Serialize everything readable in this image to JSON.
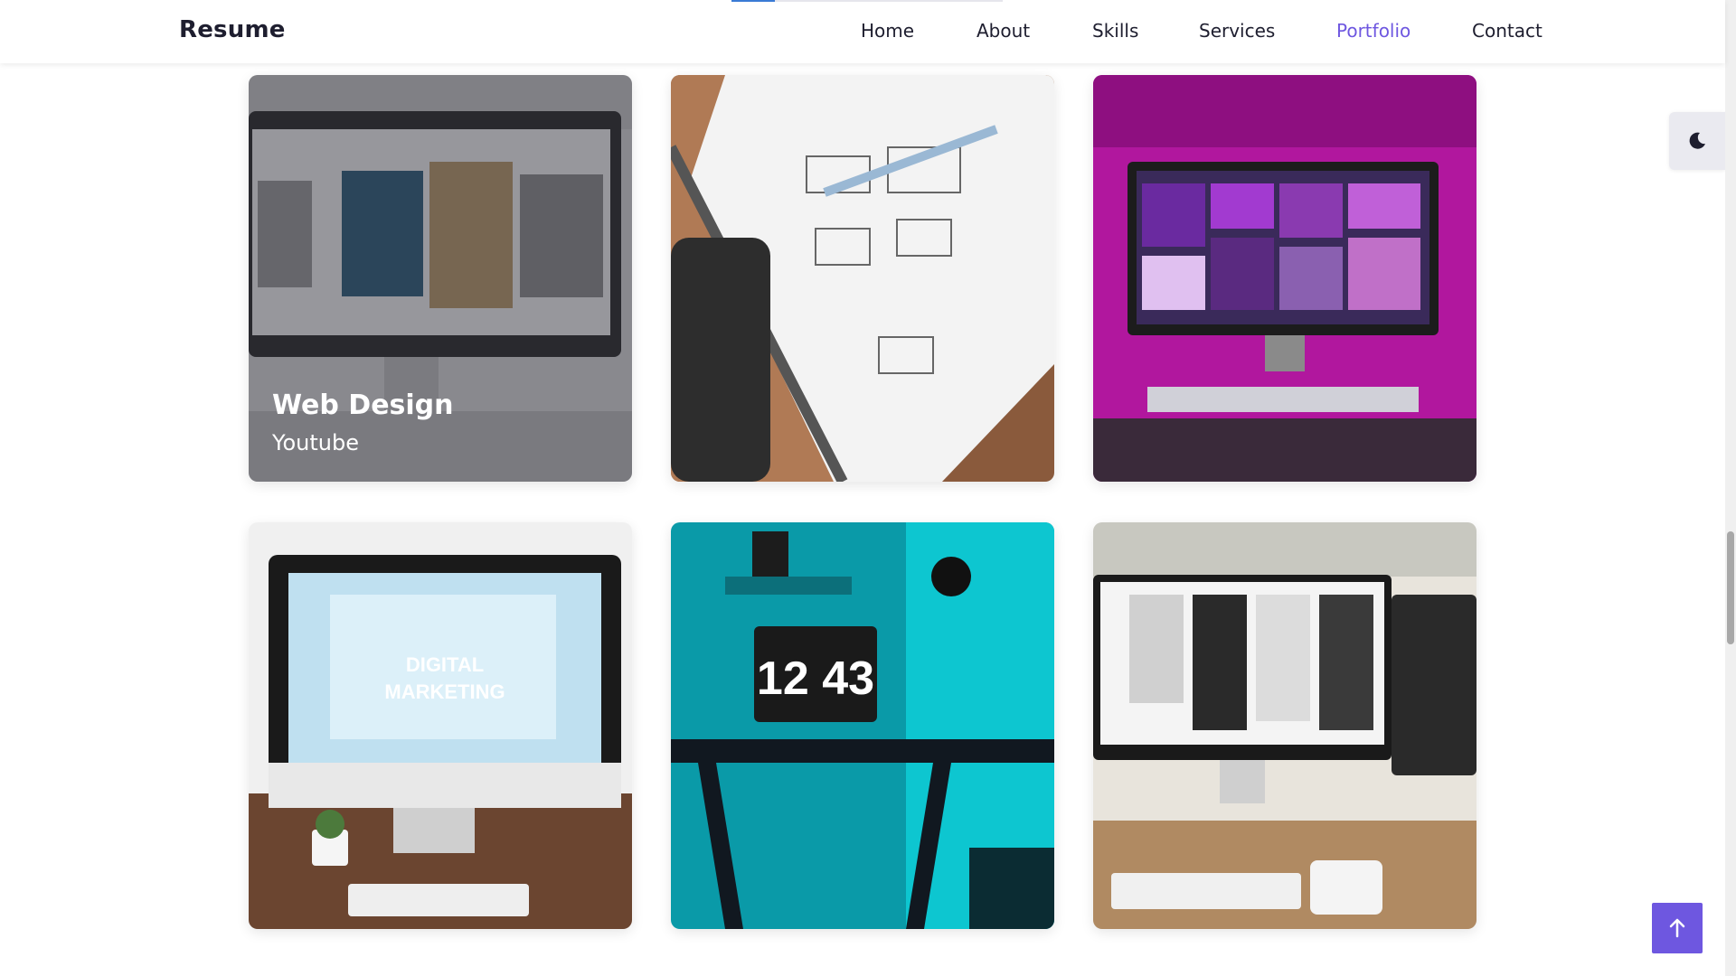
{
  "header": {
    "logo": "Resume",
    "nav": [
      {
        "label": "Home"
      },
      {
        "label": "About"
      },
      {
        "label": "Skills"
      },
      {
        "label": "Services"
      },
      {
        "label": "Portfolio",
        "active": true
      },
      {
        "label": "Contact"
      }
    ],
    "scroll_progress": 0.16
  },
  "portfolio": {
    "items": [
      {
        "title": "Web Design",
        "subtitle": "Youtube"
      },
      {
        "title": "",
        "subtitle": ""
      },
      {
        "title": "",
        "subtitle": ""
      },
      {
        "title": "",
        "subtitle": ""
      },
      {
        "title": "",
        "subtitle": ""
      },
      {
        "title": "",
        "subtitle": ""
      }
    ],
    "screen_texts": {
      "marketing_line1": "DIGITAL",
      "marketing_line2": "MARKETING",
      "clock": "12 43"
    }
  },
  "icons": {
    "theme_toggle": "moon-icon",
    "back_to_top": "arrow-up-icon"
  },
  "colors": {
    "accent": "#6e57e0",
    "text_dark": "#1e1e2f",
    "progress": "#3a7bd5"
  }
}
